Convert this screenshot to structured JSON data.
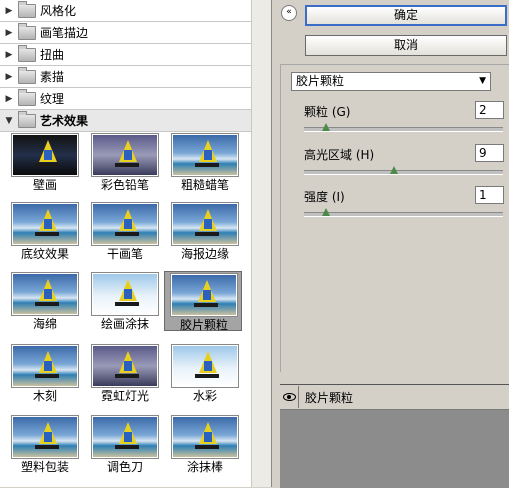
{
  "tree": {
    "categories": [
      {
        "label": "风格化",
        "expanded": false
      },
      {
        "label": "画笔描边",
        "expanded": false
      },
      {
        "label": "扭曲",
        "expanded": false
      },
      {
        "label": "素描",
        "expanded": false
      },
      {
        "label": "纹理",
        "expanded": false
      },
      {
        "label": "艺术效果",
        "expanded": true
      }
    ]
  },
  "filters": [
    {
      "label": "壁画"
    },
    {
      "label": "彩色铅笔"
    },
    {
      "label": "粗糙蜡笔"
    },
    {
      "label": "底纹效果"
    },
    {
      "label": "干画笔"
    },
    {
      "label": "海报边缘"
    },
    {
      "label": "海绵"
    },
    {
      "label": "绘画涂抹"
    },
    {
      "label": "胶片颗粒",
      "selected": true
    },
    {
      "label": "木刻"
    },
    {
      "label": "霓虹灯光"
    },
    {
      "label": "水彩"
    },
    {
      "label": "塑料包装"
    },
    {
      "label": "调色刀"
    },
    {
      "label": "涂抹棒"
    }
  ],
  "buttons": {
    "ok": "确定",
    "cancel": "取消"
  },
  "filter_select": {
    "value": "胶片颗粒"
  },
  "params": [
    {
      "label": "颗粒 (G)",
      "value": "2",
      "level": 0.11
    },
    {
      "label": "高光区域 (H)",
      "value": "9",
      "level": 0.45
    },
    {
      "label": "强度 (I)",
      "value": "1",
      "level": 0.11
    }
  ],
  "layer": {
    "name": "胶片颗粒"
  },
  "colors": {
    "accent": "#3a6cc8",
    "slider_handle": "#4d8a4a",
    "selected_cell": "#a4a4a4"
  }
}
